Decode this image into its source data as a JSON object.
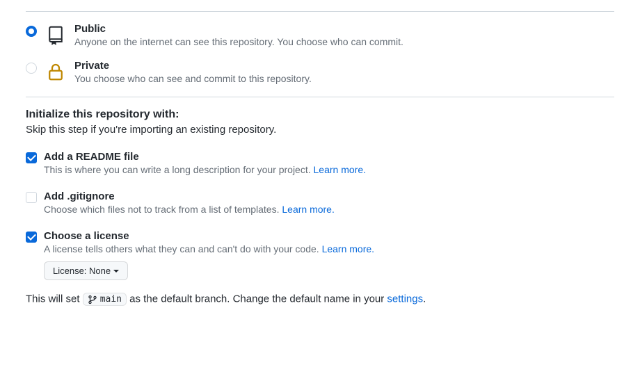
{
  "visibility": {
    "public": {
      "title": "Public",
      "desc": "Anyone on the internet can see this repository. You choose who can commit."
    },
    "private": {
      "title": "Private",
      "desc": "You choose who can see and commit to this repository."
    }
  },
  "init": {
    "heading": "Initialize this repository with:",
    "sub": "Skip this step if you're importing an existing repository.",
    "readme": {
      "title": "Add a README file",
      "desc": "This is where you can write a long description for your project. ",
      "link": "Learn more."
    },
    "gitignore": {
      "title": "Add .gitignore",
      "desc": "Choose which files not to track from a list of templates. ",
      "link": "Learn more."
    },
    "license": {
      "title": "Choose a license",
      "desc": "A license tells others what they can and can't do with your code. ",
      "link": "Learn more.",
      "button": "License: None"
    }
  },
  "branch": {
    "prefix": "This will set ",
    "name": "main",
    "middle": " as the default branch. Change the default name in your ",
    "settings": "settings",
    "suffix": "."
  }
}
